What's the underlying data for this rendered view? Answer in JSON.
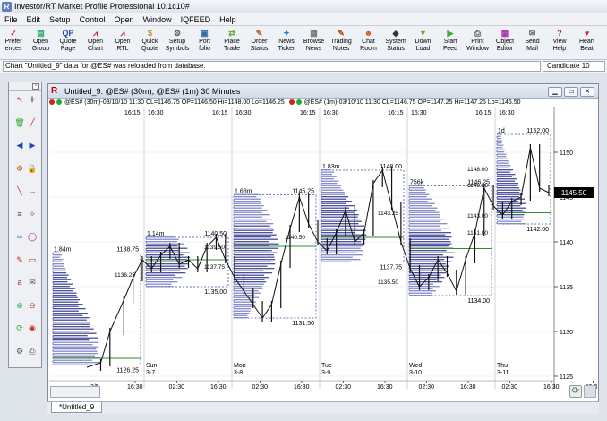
{
  "app": {
    "title": "Investor/RT Market Profile Professional 10.1c10#"
  },
  "menu": [
    "File",
    "Edit",
    "Setup",
    "Control",
    "Open",
    "Window",
    "IQFEED",
    "Help"
  ],
  "toolbar": [
    {
      "label": "Prefer\nences",
      "icon": "preferences-icon",
      "glyph": "✓",
      "color": "#c33"
    },
    {
      "label": "Open\nGroup",
      "icon": "open-group-icon",
      "glyph": "▤",
      "color": "#2a6"
    },
    {
      "label": "Quote\nPage",
      "icon": "quote-page-icon",
      "glyph": "QP",
      "color": "#24a"
    },
    {
      "label": "Open\nChart",
      "icon": "open-chart-icon",
      "glyph": "⩘",
      "color": "#b22"
    },
    {
      "label": "Open\nRTL",
      "icon": "open-rtl-icon",
      "glyph": "⩘",
      "color": "#b22"
    },
    {
      "label": "Quick\nQuote",
      "icon": "quick-quote-icon",
      "glyph": "$",
      "color": "#c80"
    },
    {
      "label": "Setup\nSymbols",
      "icon": "setup-symbols-icon",
      "glyph": "⚙",
      "color": "#555"
    },
    {
      "label": "Port\nfolio",
      "icon": "portfolio-icon",
      "glyph": "▣",
      "color": "#36a"
    },
    {
      "label": "Place\nTrade",
      "icon": "place-trade-icon",
      "glyph": "⇄",
      "color": "#6a3"
    },
    {
      "label": "Order\nStatus",
      "icon": "order-status-icon",
      "glyph": "✎",
      "color": "#a63"
    },
    {
      "label": "News\nTicker",
      "icon": "news-ticker-icon",
      "glyph": "✦",
      "color": "#27c"
    },
    {
      "label": "Browse\nNews",
      "icon": "browse-news-icon",
      "glyph": "▦",
      "color": "#777"
    },
    {
      "label": "Trading\nNotes",
      "icon": "trading-notes-icon",
      "glyph": "✎",
      "color": "#a52"
    },
    {
      "label": "Chat\nRoom",
      "icon": "chat-room-icon",
      "glyph": "☻",
      "color": "#d52"
    },
    {
      "label": "System\nStatus",
      "icon": "system-status-icon",
      "glyph": "◆",
      "color": "#333"
    },
    {
      "label": "Down\nLoad",
      "icon": "download-icon",
      "glyph": "▼",
      "color": "#7a2"
    },
    {
      "label": "Start\nFeed",
      "icon": "start-feed-icon",
      "glyph": "▶",
      "color": "#3a3"
    },
    {
      "label": "Print\nWindow",
      "icon": "print-window-icon",
      "glyph": "⎙",
      "color": "#555"
    },
    {
      "label": "Object\nEditor",
      "icon": "object-editor-icon",
      "glyph": "▦",
      "color": "#a3a"
    },
    {
      "label": "Send\nMail",
      "icon": "send-mail-icon",
      "glyph": "✉",
      "color": "#666"
    },
    {
      "label": "View\nHelp",
      "icon": "view-help-icon",
      "glyph": "?",
      "color": "#c22"
    },
    {
      "label": "Heart\nBeat",
      "icon": "heartbeat-icon",
      "glyph": "♥",
      "color": "#d22"
    }
  ],
  "status": {
    "message": "Chart \"Untitled_9\" data for @ES# was reloaded from database.",
    "candidate": "Candidate 10"
  },
  "chart_window": {
    "title": "Untitled_9: @ES# (30m), @ES# (1m) 30 Minutes",
    "info1": "@ES# (30m)-03/10/10 11:30 CL=1146.75 OP=1146.50 Hi=1148.00 Lo=1146.25",
    "info2": "@ES# (1m)-03/10/10 11:30 CL=1146.75 OP=1147.25 Hi=1147.25 Lo=1146.50",
    "tab": "*Untitled_9",
    "zoom_icon": "zoom-icon"
  },
  "chart_data": {
    "type": "market-profile",
    "instrument": "@ES#",
    "ylim": [
      1125,
      1154
    ],
    "y_ticks": [
      1125,
      1130,
      1135,
      1140,
      1145,
      1150
    ],
    "last_price": "1145.50",
    "top_time_labels": [
      "16:15",
      "16:30",
      "16:15",
      "16:30",
      "16:15",
      "16:30",
      "16:15",
      "16:30",
      "16:15",
      "16:30"
    ],
    "day_labels": [
      {
        "day": "",
        "date": "3/5"
      },
      {
        "day": "Sun",
        "date": "3-7"
      },
      {
        "day": "Mon",
        "date": "3-8"
      },
      {
        "day": "Tue",
        "date": "3-9"
      },
      {
        "day": "Wed",
        "date": "3-10"
      },
      {
        "day": "Thu",
        "date": "3-11"
      }
    ],
    "x_ticks": [
      "16:30",
      "02:30",
      "16:30",
      "02:30",
      "16:30",
      "02:30",
      "16:30",
      "02:30",
      "16:30",
      "02:30",
      "16:30",
      "02:30"
    ],
    "profiles": [
      {
        "session": "3/5",
        "volume": "1.84m",
        "hi": "1138.75",
        "lo": "1126.25",
        "poc": 1127.0,
        "va_hi": 1136.5,
        "va_lo": 1129.0
      },
      {
        "session": "Sun 3-7",
        "volume": "1.14m",
        "hi": "1140.50",
        "lo": "1135.00",
        "poc": 1138.0,
        "va_hi": 1139.5,
        "va_lo": 1136.25
      },
      {
        "session": "Mon 3-8",
        "volume": "1.68m",
        "hi": "1145.25",
        "lo": "1131.50",
        "poc": 1139.5,
        "va_hi": 1141.75,
        "va_lo": 1135.5
      },
      {
        "session": "Tue 3-9",
        "volume": "1.83m",
        "hi": "1148.00",
        "lo": "1137.75",
        "poc": 1140.5,
        "va_hi": 1145.0,
        "va_lo": 1139.75
      },
      {
        "session": "Wed 3-10",
        "volume": "756k",
        "hi": "1146.25",
        "lo": "1134.00",
        "poc": 1139.25,
        "va_hi": 1141.0,
        "va_lo": 1135.5
      },
      {
        "session": "Thu 3-11",
        "volume": "1d",
        "hi": "1152.00",
        "lo": "1142.00",
        "poc": 1143.25,
        "va_hi": 1148.0,
        "va_lo": 1143.0
      }
    ],
    "side_labels": [
      {
        "text": "1136.25",
        "y": 1136.3
      },
      {
        "text": "1139.50",
        "y": 1139.4
      },
      {
        "text": "1137.75",
        "y": 1137.2
      },
      {
        "text": "1140.50",
        "y": 1140.5
      },
      {
        "text": "1135.50",
        "y": 1135.5
      },
      {
        "text": "1143.25",
        "y": 1143.2
      },
      {
        "text": "1143.00",
        "y": 1142.9
      },
      {
        "text": "1141.00",
        "y": 1141.0
      },
      {
        "text": "1146.25",
        "y": 1146.3
      },
      {
        "text": "1148.00",
        "y": 1148.1
      }
    ],
    "price_path": [
      [
        0.0,
        1126.0
      ],
      [
        0.03,
        1126.5
      ],
      [
        0.05,
        1130.0
      ],
      [
        0.08,
        1133.5
      ],
      [
        0.1,
        1136.0
      ],
      [
        0.12,
        1138.0
      ],
      [
        0.14,
        1137.0
      ],
      [
        0.16,
        1138.5
      ],
      [
        0.18,
        1139.5
      ],
      [
        0.2,
        1137.5
      ],
      [
        0.22,
        1138.0
      ],
      [
        0.24,
        1137.0
      ],
      [
        0.26,
        1139.5
      ],
      [
        0.28,
        1140.5
      ],
      [
        0.3,
        1138.0
      ],
      [
        0.32,
        1136.0
      ],
      [
        0.34,
        1134.5
      ],
      [
        0.36,
        1133.0
      ],
      [
        0.38,
        1131.5
      ],
      [
        0.4,
        1133.0
      ],
      [
        0.42,
        1137.5
      ],
      [
        0.44,
        1141.5
      ],
      [
        0.46,
        1145.0
      ],
      [
        0.48,
        1142.0
      ],
      [
        0.5,
        1140.0
      ],
      [
        0.52,
        1139.0
      ],
      [
        0.54,
        1141.0
      ],
      [
        0.56,
        1143.5
      ],
      [
        0.58,
        1140.0
      ],
      [
        0.6,
        1141.0
      ],
      [
        0.62,
        1146.5
      ],
      [
        0.64,
        1148.0
      ],
      [
        0.66,
        1144.0
      ],
      [
        0.68,
        1140.0
      ],
      [
        0.7,
        1137.0
      ],
      [
        0.72,
        1135.0
      ],
      [
        0.74,
        1136.0
      ],
      [
        0.76,
        1138.0
      ],
      [
        0.78,
        1136.5
      ],
      [
        0.8,
        1134.5
      ],
      [
        0.82,
        1138.0
      ],
      [
        0.84,
        1141.0
      ],
      [
        0.86,
        1146.0
      ],
      [
        0.88,
        1144.0
      ],
      [
        0.9,
        1143.0
      ],
      [
        0.92,
        1144.5
      ],
      [
        0.94,
        1145.0
      ],
      [
        0.96,
        1150.5
      ],
      [
        0.98,
        1146.0
      ],
      [
        1.0,
        1145.5
      ]
    ]
  },
  "palette_icons": [
    "pointer-icon",
    "crosshair-icon",
    "delete-icon",
    "trendline-icon",
    "arrow-left-icon",
    "arrow-right-icon",
    "fibonacci-icon",
    "lock-icon",
    "diagonal-line-icon",
    "ray-icon",
    "channel-icon",
    "gann-icon",
    "cycle-icon",
    "ellipse-icon",
    "pen-icon",
    "box-icon",
    "text-icon",
    "note-icon",
    "zoom-in-icon",
    "zoom-out-icon",
    "refresh-icon",
    "camera-icon",
    "settings-icon",
    "print-icon"
  ]
}
